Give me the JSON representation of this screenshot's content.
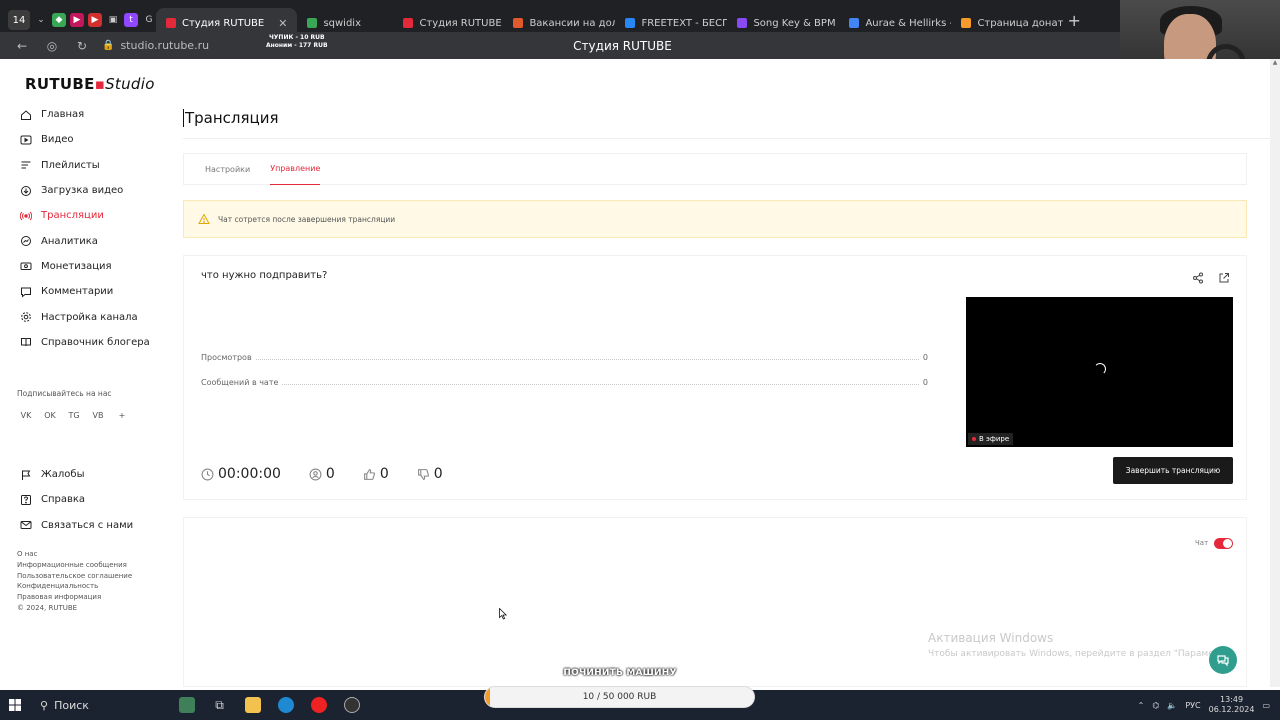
{
  "browser": {
    "tab_counter": "14",
    "tabs": [
      {
        "label": "Студия RUTUBE",
        "active": true,
        "color": "#e4293a"
      },
      {
        "label": "sqwidix",
        "active": false,
        "color": "#3aa757"
      },
      {
        "label": "Студия RUTUBE",
        "active": false,
        "color": "#e4293a"
      },
      {
        "label": "Вакансии на должн",
        "active": false,
        "color": "#e05a2b"
      },
      {
        "label": "FREETEXT - БЕСПЛ",
        "active": false,
        "color": "#2787f5"
      },
      {
        "label": "Song Key & BPM Fin",
        "active": false,
        "color": "#8a4af3"
      },
      {
        "label": "Aurae & Hellirks - eF",
        "active": false,
        "color": "#4285f4"
      },
      {
        "label": "Страница донатов",
        "active": false,
        "color": "#f59b2b"
      }
    ],
    "url": "studio.rutube.ru",
    "page_title": "Студия RUTUBE",
    "donation_line1": "ЧУПИК - 10 RUB",
    "donation_line2": "Аноним - 177 RUB"
  },
  "logo": {
    "part1": "RUTUBE",
    "part2": "Studio"
  },
  "sidebar": {
    "items": [
      {
        "label": "Главная",
        "icon": "home-icon"
      },
      {
        "label": "Видео",
        "icon": "video-icon"
      },
      {
        "label": "Плейлисты",
        "icon": "playlist-icon"
      },
      {
        "label": "Загрузка видео",
        "icon": "upload-icon"
      },
      {
        "label": "Трансляции",
        "icon": "broadcast-icon",
        "active": true
      },
      {
        "label": "Аналитика",
        "icon": "analytics-icon"
      },
      {
        "label": "Монетизация",
        "icon": "money-icon"
      },
      {
        "label": "Комментарии",
        "icon": "comment-icon"
      },
      {
        "label": "Настройка канала",
        "icon": "settings-icon"
      },
      {
        "label": "Справочник блогера",
        "icon": "book-icon"
      }
    ],
    "follow_label": "Подписывайтесь на нас",
    "socials": [
      "VK",
      "OK",
      "TG",
      "VB",
      "+"
    ],
    "bottom_items": [
      {
        "label": "Жалобы",
        "icon": "flag-icon"
      },
      {
        "label": "Справка",
        "icon": "help-icon"
      },
      {
        "label": "Связаться с нами",
        "icon": "mail-icon"
      }
    ],
    "footer_links": [
      "О нас",
      "Информационные сообщения",
      "Пользовательское соглашение",
      "Конфиденциальность",
      "Правовая информация",
      "© 2024, RUTUBE"
    ]
  },
  "main": {
    "page_title": "Трансляция",
    "tabs": [
      {
        "label": "Настройки",
        "active": false
      },
      {
        "label": "Управление",
        "active": true
      }
    ],
    "alert_text": "Чат сотрется после завершения трансляции",
    "stream_title": "что нужно подправить?",
    "stats": [
      {
        "label": "Просмотров",
        "value": "0"
      },
      {
        "label": "Сообщений в чате",
        "value": "0"
      }
    ],
    "live_badge": "В эфире",
    "metrics": {
      "duration": "00:00:00",
      "viewers": "0",
      "likes": "0",
      "dislikes": "0"
    },
    "end_button": "Завершить трансляцию",
    "chat_label": "Чат",
    "chat_enabled": true
  },
  "watermark": {
    "line1": "Активация Windows",
    "line2": "Чтобы активировать Windows, перейдите в раздел \"Парамет"
  },
  "donation_goal": {
    "title": "ПОЧИНИТЬ МАШИНУ",
    "label": "10 / 50 000 RUB",
    "progress": 0.0002
  },
  "taskbar": {
    "search": "Поиск",
    "lang": "РУС",
    "time": "13:49",
    "date": "06.12.2024"
  },
  "colors": {
    "accent": "#e4293a",
    "dark": "#1a1a1a",
    "alert_bg": "#fff9e6",
    "support": "#2f9e8f"
  }
}
